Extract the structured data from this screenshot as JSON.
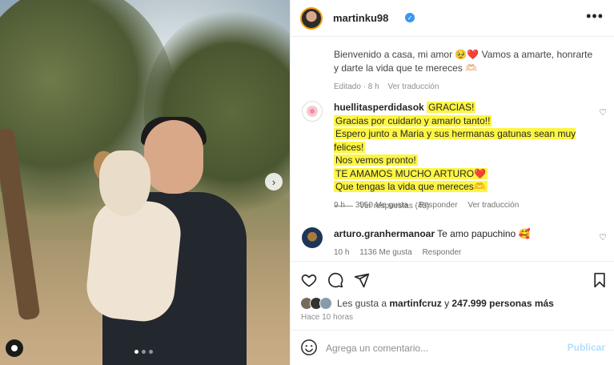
{
  "post": {
    "username": "martinku98",
    "more_icon": "ellipsis-icon",
    "caption": "Bienvenido a casa, mi amor 🥹❤️ Vamos a amarte, honrarte y darte la vida que te mereces 🫶🏻",
    "caption_edited": "Editado · 8 h",
    "caption_translate": "Ver traducción"
  },
  "comments": [
    {
      "username": "huellitasperdidasok",
      "lines": [
        "GRACIAS!",
        "Gracias por cuidarlo y amarlo tanto!!",
        "Espero junto a Maria y sus hermanas gatunas sean muy felices!",
        "Nos vemos pronto!",
        "TE AMAMOS MUCHO ARTURO❤️",
        "Que tengas la vida que mereces🫶"
      ],
      "time": "9 h",
      "likes": "3550 Me gusta",
      "reply": "Responder",
      "translate": "Ver traducción",
      "replies": "Ver respuestas (45)"
    },
    {
      "username": "arturo.granhermanoar",
      "text": "Te amo papuchino 🥰",
      "time": "10 h",
      "likes": "1136 Me gusta",
      "reply": "Responder"
    }
  ],
  "likes_summary": {
    "prefix": "Les gusta a",
    "user": "martinfcruz",
    "connector": "y",
    "count": "247.999 personas más"
  },
  "posted_ago": "Hace 10 horas",
  "add_comment": {
    "placeholder": "Agrega un comentario...",
    "publish": "Publicar"
  },
  "carousel": {
    "total_slides": 3,
    "active_slide": 1
  }
}
